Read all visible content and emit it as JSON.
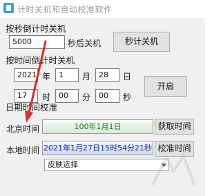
{
  "window": {
    "title": "计时关机和自动校准软件",
    "icon": "app-icon"
  },
  "countdown_section": {
    "heading": "按秒倒计时关机",
    "seconds_value": "5000",
    "suffix": "秒后关机",
    "button": "秒计关机"
  },
  "time_section": {
    "heading": "按时间倒计时关机",
    "year": "2021",
    "year_unit": "年",
    "month": "1",
    "month_unit": "月",
    "day": "28",
    "day_unit": "日",
    "hour": "17",
    "hour_unit": "时",
    "minute": "00",
    "minute_unit": "分",
    "second": "00",
    "second_unit": "秒",
    "button": "开启"
  },
  "date_section": {
    "heading": "日期时间校准",
    "beijing_label": "北京时间",
    "beijing_value": "100年1月1日",
    "beijing_button": "获取时间",
    "local_label": "本地时间",
    "local_value": "2021年1月27日15时54分21秒",
    "local_button": "校准时间"
  },
  "skin": {
    "selected": "皮肤选择"
  },
  "colors": {
    "annotation_arrow": "#d62e2e",
    "beijing_text": "#1f6d1f",
    "local_text": "#1b2f86"
  }
}
